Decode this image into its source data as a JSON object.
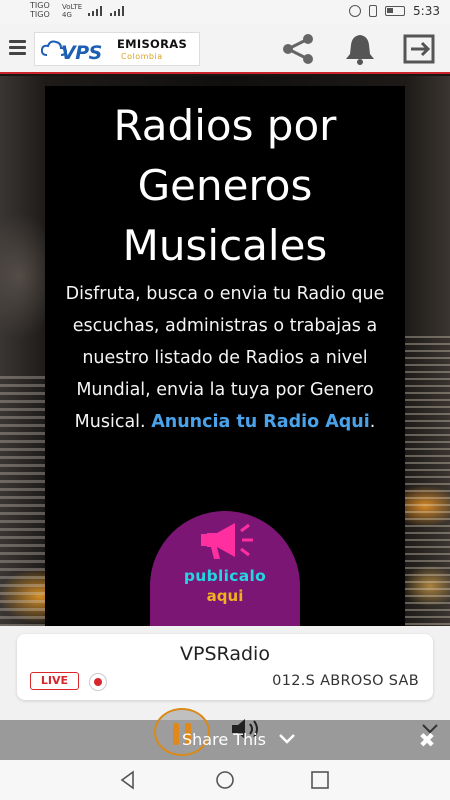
{
  "status_bar": {
    "carrier_1": "TIGO",
    "carrier_2": "TIGO",
    "network_1": "VoLTE",
    "network_2": "4G",
    "time": "5:33"
  },
  "app_header": {
    "logo_brand": "VPS",
    "logo_title": "EMISORAS",
    "logo_subtitle": "Colombia",
    "icons": [
      "menu-icon",
      "share-icon",
      "bell-icon",
      "logout-icon"
    ]
  },
  "card": {
    "title_line_1": "Radios por",
    "title_line_2": "Generos",
    "title_line_3": "Musicales",
    "description": "Disfruta, busca o envia tu Radio que escuchas, administras o trabajas a nuestro listado de Radios a nivel Mundial, envia la tuya por Genero Musical. ",
    "link_text": "Anuncia tu Radio Aqui",
    "link_suffix": ".",
    "promo_line_1": "publicalo",
    "promo_line_2": "aqui"
  },
  "player": {
    "station_name": "VPSRadio",
    "live_label": "LIVE",
    "now_playing": "012.S ABROSO SAB"
  },
  "share_bar": {
    "label": "Share This"
  },
  "colors": {
    "accent_red": "#c9252b",
    "link_blue": "#4aa3ea",
    "promo_purple": "#7c1674",
    "promo_cyan": "#22d7e3",
    "promo_gold": "#f0b21e",
    "pause_orange": "#e0891a"
  }
}
